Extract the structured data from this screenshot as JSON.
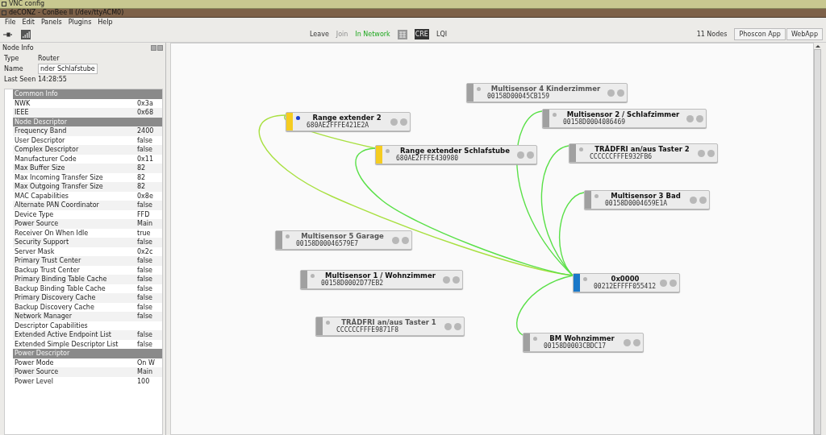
{
  "vnc_bar": {
    "title": "VNC config"
  },
  "window": {
    "title": "deCONZ - ConBee II (/dev/ttyACM0)"
  },
  "menu": [
    "File",
    "Edit",
    "Panels",
    "Plugins",
    "Help"
  ],
  "toolbar": {
    "leave": "Leave",
    "join": {
      "label": "Join",
      "disabled": true
    },
    "status": "In Network",
    "cre": "CRE",
    "lqi": "LQI",
    "node_count": "11 Nodes",
    "buttons": [
      "Phoscon App",
      "WebApp"
    ]
  },
  "node_info": {
    "title": "Node Info",
    "fields": [
      {
        "kind": "text",
        "label": "Type",
        "value": "Router"
      },
      {
        "kind": "input",
        "label": "Name",
        "value": "nder Schlafstube"
      },
      {
        "kind": "text",
        "label": "Last Seen",
        "value": "14:28:55"
      }
    ],
    "properties": [
      {
        "kind": "header",
        "key": "Common Info"
      },
      {
        "kind": "row",
        "key": "NWK",
        "value": "0x3a"
      },
      {
        "kind": "row",
        "key": "IEEE",
        "value": "0x68"
      },
      {
        "kind": "header",
        "key": "Node Descriptor"
      },
      {
        "kind": "row",
        "key": "Frequency Band",
        "value": "2400"
      },
      {
        "kind": "row",
        "key": "User Descriptor",
        "value": "false"
      },
      {
        "kind": "row",
        "key": "Complex Descriptor",
        "value": "false"
      },
      {
        "kind": "row",
        "key": "Manufacturer Code",
        "value": "0x11"
      },
      {
        "kind": "row",
        "key": "Max Buffer Size",
        "value": "82"
      },
      {
        "kind": "row",
        "key": "Max Incoming Transfer Size",
        "value": "82"
      },
      {
        "kind": "row",
        "key": "Max Outgoing Transfer Size",
        "value": "82"
      },
      {
        "kind": "row",
        "key": "MAC Capabilities",
        "value": "0x8e"
      },
      {
        "kind": "row",
        "key": "Alternate PAN Coordinator",
        "value": "false"
      },
      {
        "kind": "row",
        "key": "Device Type",
        "value": "FFD"
      },
      {
        "kind": "row",
        "key": "Power Source",
        "value": "Main"
      },
      {
        "kind": "row",
        "key": "Receiver On When Idle",
        "value": "true"
      },
      {
        "kind": "row",
        "key": "Security Support",
        "value": "false"
      },
      {
        "kind": "row",
        "key": "Server Mask",
        "value": "0x2c"
      },
      {
        "kind": "row",
        "key": "Primary Trust Center",
        "value": "false"
      },
      {
        "kind": "row",
        "key": "Backup Trust Center",
        "value": "false"
      },
      {
        "kind": "row",
        "key": "Primary Binding Table Cache",
        "value": "false"
      },
      {
        "kind": "row",
        "key": "Backup Binding Table Cache",
        "value": "false"
      },
      {
        "kind": "row",
        "key": "Primary Discovery Cache",
        "value": "false"
      },
      {
        "kind": "row",
        "key": "Backup Discovery Cache",
        "value": "false"
      },
      {
        "kind": "row",
        "key": "Network Manager",
        "value": "false"
      },
      {
        "kind": "row",
        "key": "Descriptor Capabilities"
      },
      {
        "kind": "row",
        "key": "Extended Active Endpoint List",
        "value": "false"
      },
      {
        "kind": "row",
        "key": "Extended Simple Descriptor List",
        "value": "false"
      },
      {
        "kind": "header",
        "key": "Power Descriptor"
      },
      {
        "kind": "row",
        "key": "Power Mode",
        "value": "On W"
      },
      {
        "kind": "row",
        "key": "Power Source",
        "value": "Main"
      },
      {
        "kind": "row",
        "key": "Power Level",
        "value": "100"
      }
    ]
  },
  "nodes": [
    {
      "kind": "end_device",
      "name": "Multisensor 4 Kinderzimmer",
      "address": "00158D00045CB159",
      "dimmed": true,
      "marked": false
    },
    {
      "kind": "end_device",
      "name": "Multisensor 2 / Schlafzimmer",
      "address": "00158D0004086469",
      "dimmed": false,
      "marked": false
    },
    {
      "kind": "router",
      "name": "Range extender 2",
      "address": "680AE2FFFE421E2A",
      "dimmed": false,
      "marked": true
    },
    {
      "kind": "router",
      "name": "Range extender Schlafstube",
      "address": "680AE2FFFE430980",
      "dimmed": false,
      "marked": false
    },
    {
      "kind": "end_device",
      "name": "TRÅDFRI an/aus Taster 2",
      "address": "CCCCCCFFFE932FB6",
      "dimmed": false,
      "marked": false
    },
    {
      "kind": "end_device",
      "name": "Multisensor 3 Bad",
      "address": "00158D0004659E1A",
      "dimmed": false,
      "marked": false
    },
    {
      "kind": "end_device",
      "name": "Multisensor 5 Garage",
      "address": "00158D00046579E7",
      "dimmed": true,
      "marked": false
    },
    {
      "kind": "end_device",
      "name": "Multisensor 1 / Wohnzimmer",
      "address": "00158D0002D77EB2",
      "dimmed": false,
      "marked": false
    },
    {
      "kind": "coordinator",
      "name": "0x0000",
      "address": "00212EFFFF055412",
      "dimmed": false,
      "marked": false
    },
    {
      "kind": "end_device",
      "name": "TRÅDFRI an/aus Taster 1",
      "address": "CCCCCCFFFE9871F8",
      "dimmed": true,
      "marked": false
    },
    {
      "kind": "end_device",
      "name": "BM Wohnzimmer",
      "address": "00158D0003CBDC17",
      "dimmed": false,
      "marked": false
    }
  ]
}
